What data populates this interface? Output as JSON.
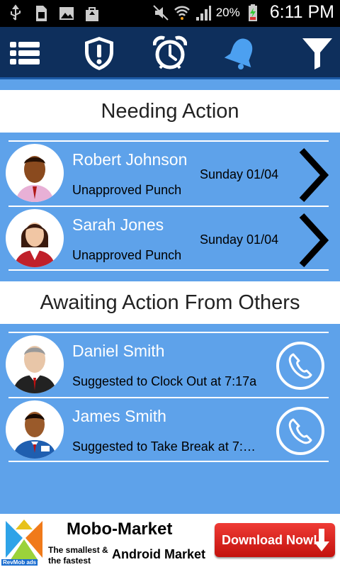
{
  "status_bar": {
    "battery_percent": "20%",
    "time": "6:11 PM"
  },
  "toolbar": {
    "icons": [
      "menu-list-icon",
      "shield-alert-icon",
      "alarm-clock-icon",
      "bell-icon",
      "filter-icon"
    ]
  },
  "needing_action": {
    "title": "Needing Action",
    "items": [
      {
        "name": "Robert Johnson",
        "status": "Unapproved Punch",
        "date": "Sunday 01/04"
      },
      {
        "name": "Sarah Jones",
        "status": "Unapproved Punch",
        "date": "Sunday 01/04"
      }
    ]
  },
  "awaiting_action": {
    "title": "Awaiting Action From Others",
    "items": [
      {
        "name": "Daniel Smith",
        "status": "Suggested to Clock Out at 7:17a"
      },
      {
        "name": "James Smith",
        "status": "Suggested to Take Break at 7:…"
      }
    ]
  },
  "ad": {
    "brand": "RevMob ads",
    "title": "Mobo-Market",
    "tagline_1": "The smallest &",
    "tagline_2": "the fastest",
    "subtitle": "Android Market",
    "button_label": "Download Now!"
  },
  "colors": {
    "background": "#5ea2ea",
    "toolbar": "#0e2f5c",
    "header_bg": "#ffffff"
  }
}
